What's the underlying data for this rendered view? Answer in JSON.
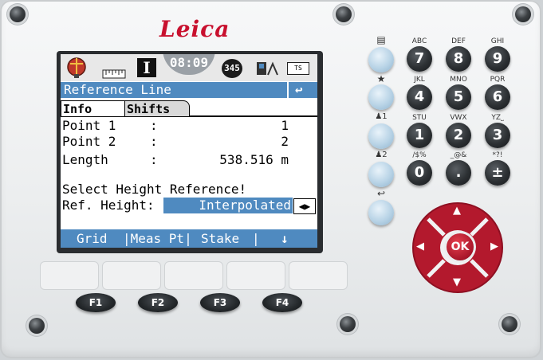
{
  "brand": "Leica",
  "status": {
    "clock": "08:09",
    "mode_letter": "I",
    "badge": "345",
    "battery_label": "TS"
  },
  "title": "Reference Line",
  "back_glyph": "↩",
  "tabs": [
    {
      "label": "Info",
      "active": true
    },
    {
      "label": "Shifts",
      "active": false
    }
  ],
  "rows": [
    {
      "label": "Point 1",
      "sep": ":",
      "value": "1"
    },
    {
      "label": "Point 2",
      "sep": ":",
      "value": "2"
    },
    {
      "label": "Length",
      "sep": ":",
      "value": "538.516 m"
    }
  ],
  "prompt": "Select Height Reference!",
  "ref_height": {
    "label": "Ref. Height:",
    "value": "Interpolated"
  },
  "softkeys": [
    "Grid",
    "|Meas Pt|",
    "Stake",
    "|",
    "↓"
  ],
  "function_keys": [
    "F1",
    "F2",
    "F3",
    "F4"
  ],
  "keypad": [
    {
      "label": "ABC",
      "key": "7"
    },
    {
      "label": "DEF",
      "key": "8"
    },
    {
      "label": "GHI",
      "key": "9"
    },
    {
      "label": "JKL",
      "key": "4"
    },
    {
      "label": "MNO",
      "key": "5"
    },
    {
      "label": "PQR",
      "key": "6"
    },
    {
      "label": "STU",
      "key": "1"
    },
    {
      "label": "VWX",
      "key": "2"
    },
    {
      "label": "YZ⎵",
      "key": "3"
    },
    {
      "label": "/$%",
      "key": "0"
    },
    {
      "label": "_@&",
      "key": "."
    },
    {
      "label": "*?!",
      "key": "±"
    }
  ],
  "side_keys": [
    {
      "icon": "file-icon",
      "glyph": "▤"
    },
    {
      "icon": "star-icon",
      "glyph": "★"
    },
    {
      "icon": "user1-icon",
      "glyph": "♟1"
    },
    {
      "icon": "user2-icon",
      "glyph": "♟2"
    },
    {
      "icon": "return-icon",
      "glyph": "↩"
    }
  ],
  "ok_label": "OK",
  "colors": {
    "title_bar": "#4f8ac0",
    "brand": "#c8102e",
    "dpad": "#a8162a"
  }
}
